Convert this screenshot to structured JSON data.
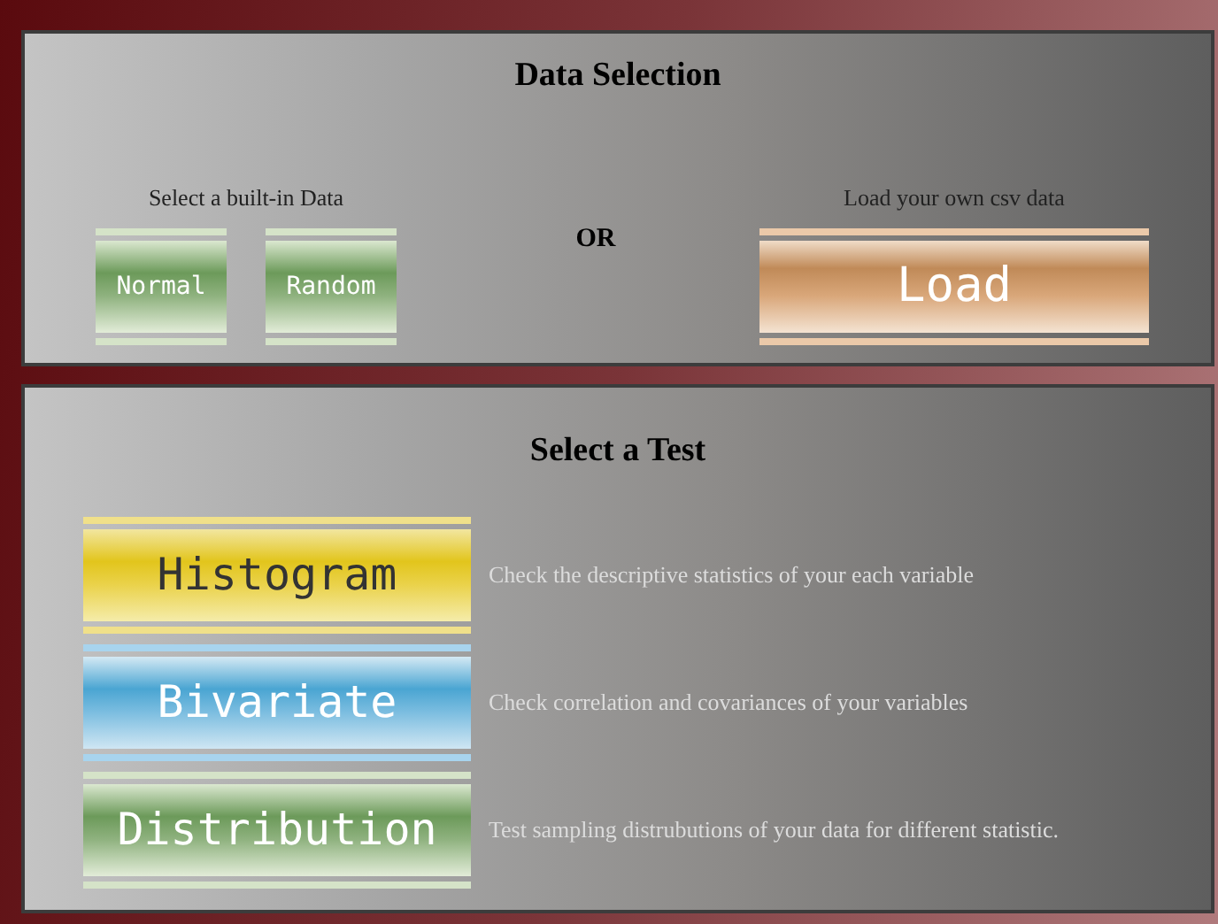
{
  "data_selection": {
    "title": "Data Selection",
    "builtin_label": "Select a built-in Data",
    "builtin_buttons": [
      {
        "label": "Normal",
        "kind": "green"
      },
      {
        "label": "Random",
        "kind": "green"
      }
    ],
    "or_text": "OR",
    "load_label": "Load your own csv data",
    "load_button": {
      "label": "Load",
      "kind": "orange"
    }
  },
  "test_selection": {
    "title": "Select a Test",
    "tests": [
      {
        "label": "Histogram",
        "kind": "yellow",
        "description": "Check the descriptive statistics of your each variable"
      },
      {
        "label": "Bivariate",
        "kind": "blue",
        "description": "Check correlation and covariances of your variables"
      },
      {
        "label": "Distribution",
        "kind": "green",
        "description": "Test sampling distrubutions of your data for different statistic."
      }
    ]
  }
}
